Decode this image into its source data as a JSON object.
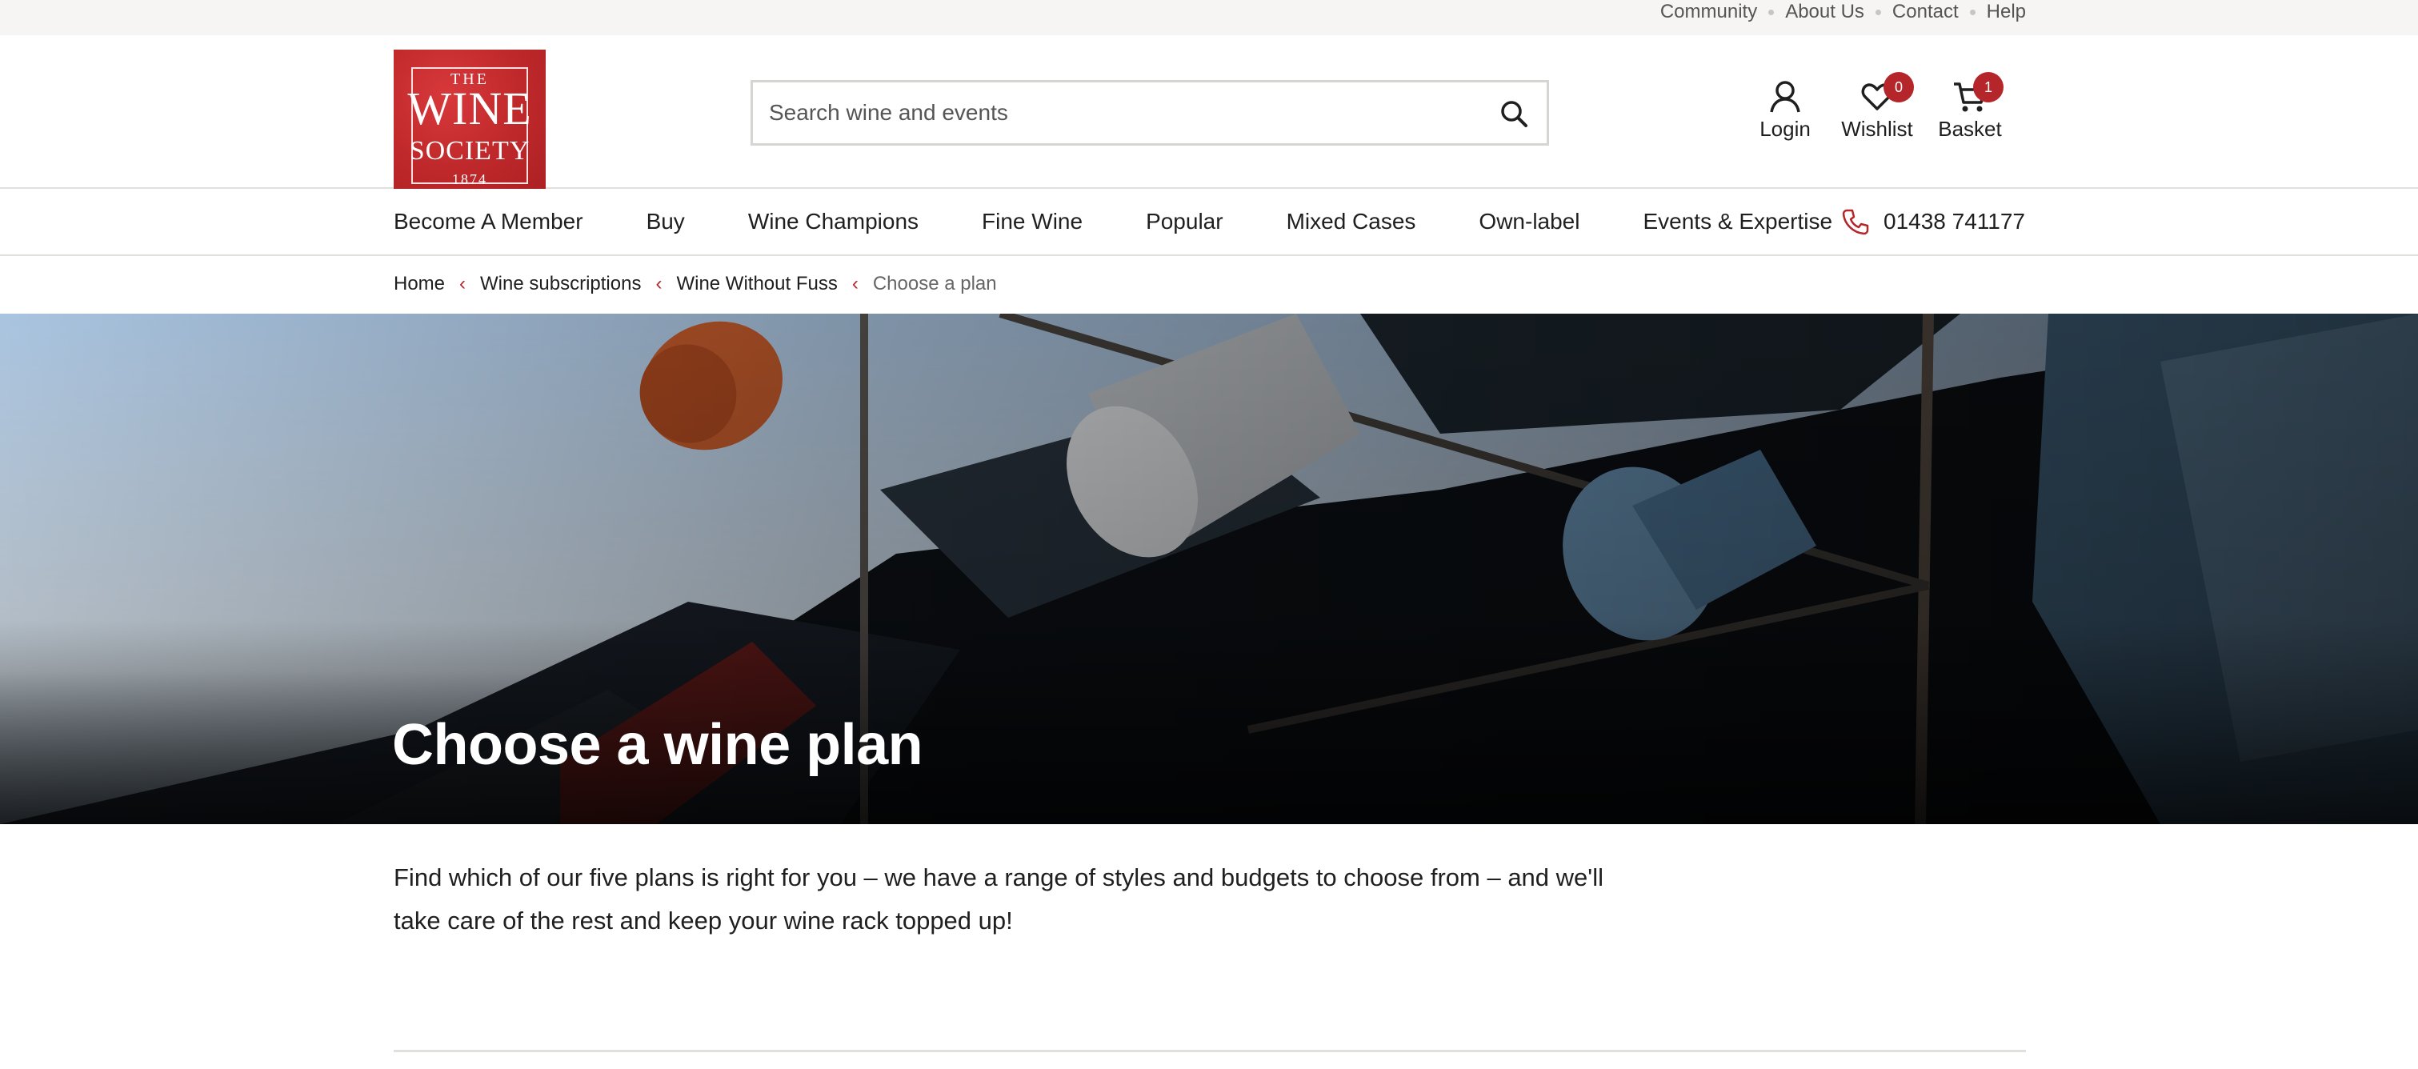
{
  "utility_nav": [
    "Community",
    "About Us",
    "Contact",
    "Help"
  ],
  "logo": {
    "line1": "THE",
    "line2": "WINE",
    "line3": "SOCIETY",
    "line4": "1874"
  },
  "search": {
    "placeholder": "Search wine and events",
    "icon": "search-icon"
  },
  "header_actions": [
    {
      "label": "Login",
      "icon": "user-icon"
    },
    {
      "label": "Wishlist",
      "icon": "heart-icon",
      "count": "0"
    },
    {
      "label": "Basket",
      "icon": "cart-icon",
      "count": "1"
    }
  ],
  "main_nav": [
    "Become A Member",
    "Buy",
    "Wine Champions",
    "Fine Wine",
    "Popular",
    "Mixed Cases",
    "Own-label",
    "Events & Expertise"
  ],
  "phone": {
    "number": "01438 741177",
    "icon": "phone-icon"
  },
  "breadcrumb": {
    "items": [
      "Home",
      "Wine subscriptions",
      "Wine Without Fuss"
    ],
    "current": "Choose a plan"
  },
  "hero": {
    "title": "Choose a wine plan"
  },
  "intro": "Find which of our five plans is right for you – we have a range of styles and budgets to choose from – and we'll take care of the rest and keep your wine rack topped up!",
  "colors": {
    "brand_red": "#b5262a",
    "utility_bg": "#f6f5f3",
    "border": "#e2e0dc"
  }
}
